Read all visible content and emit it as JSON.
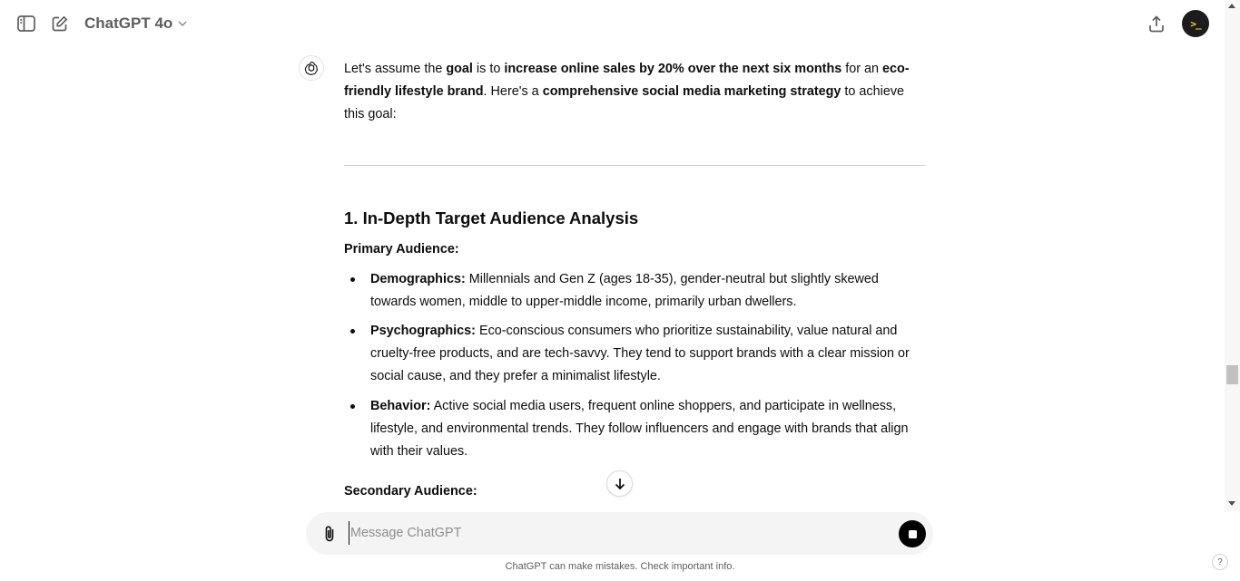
{
  "header": {
    "model_name": "ChatGPT 4o"
  },
  "message": {
    "intro": [
      {
        "t": "Let's assume the ",
        "b": false
      },
      {
        "t": "goal",
        "b": true
      },
      {
        "t": " is to ",
        "b": false
      },
      {
        "t": "increase online sales by 20% over the next six months",
        "b": true
      },
      {
        "t": " for an ",
        "b": false
      },
      {
        "t": "eco-friendly lifestyle brand",
        "b": true
      },
      {
        "t": ". Here's a ",
        "b": false
      },
      {
        "t": "comprehensive social media marketing strategy",
        "b": true
      },
      {
        "t": " to achieve this goal:",
        "b": false
      }
    ],
    "section_heading": "1. In-Depth Target Audience Analysis",
    "primary_audience_label": "Primary Audience:",
    "bullets": [
      {
        "label": "Demographics:",
        "text": " Millennials and Gen Z (ages 18-35), gender-neutral but slightly skewed towards women, middle to upper-middle income, primarily urban dwellers."
      },
      {
        "label": "Psychographics:",
        "text": " Eco-conscious consumers who prioritize sustainability, value natural and cruelty-free products, and are tech-savvy. They tend to support brands with a clear mission or social cause, and they prefer a minimalist lifestyle."
      },
      {
        "label": "Behavior:",
        "text": " Active social media users, frequent online shoppers, and participate in wellness, lifestyle, and environmental trends. They follow influencers and engage with brands that align with their values."
      }
    ],
    "secondary_audience_label": "Secondary Audience:"
  },
  "composer": {
    "placeholder": "Message ChatGPT"
  },
  "footer": {
    "disclaimer": "ChatGPT can make mistakes. Check important info.",
    "help_label": "?"
  },
  "icons": {
    "sidebar_toggle": "sidebar-toggle-icon",
    "new_chat": "edit-icon",
    "model_dropdown": "chevron-down-icon",
    "share": "share-icon",
    "assistant": "openai-logo-icon",
    "scroll_down": "arrow-down-icon",
    "attach": "paperclip-icon",
    "stop": "stop-icon"
  },
  "colors": {
    "text": "#0d0d0d",
    "muted": "#5d5d5d",
    "composer_bg": "#f4f4f4",
    "avatar_bg": "#1c1c1c",
    "avatar_fg": "#f5d442"
  },
  "avatar_text": ">_"
}
